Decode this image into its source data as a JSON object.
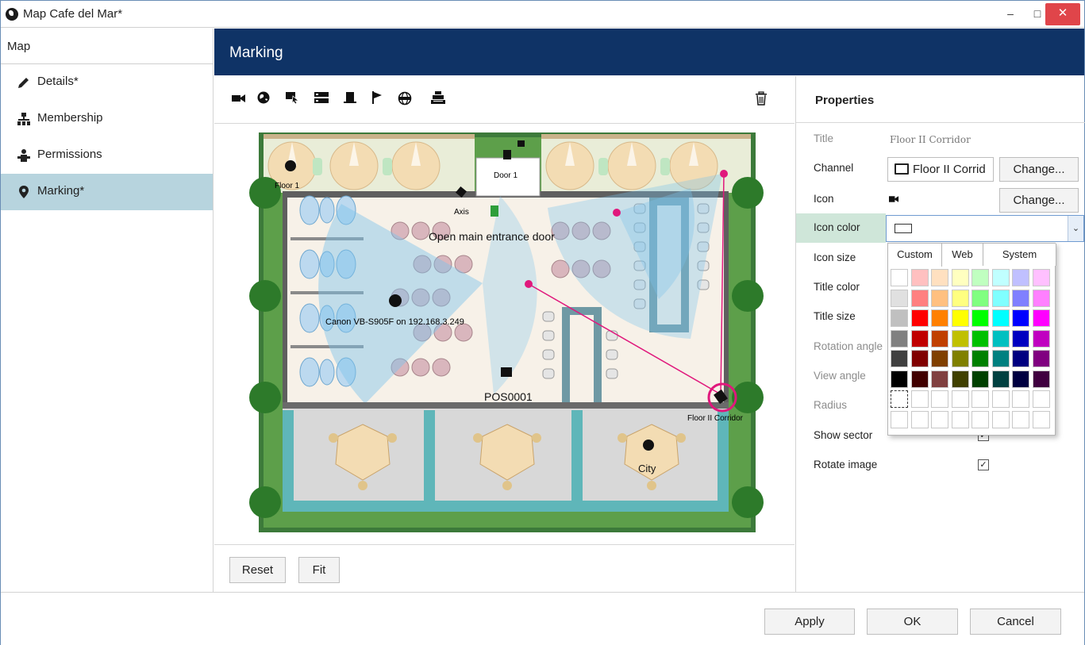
{
  "window": {
    "title": "Map Cafe del Mar*"
  },
  "nav": {
    "header": "Map",
    "items": [
      {
        "label": "Details*",
        "icon": "pencil-icon"
      },
      {
        "label": "Membership",
        "icon": "org-chart-icon"
      },
      {
        "label": "Permissions",
        "icon": "permissions-icon"
      },
      {
        "label": "Marking*",
        "icon": "location-pin-icon"
      }
    ]
  },
  "header": {
    "title": "Marking"
  },
  "toolbar": {
    "tools": [
      "camera-icon",
      "globe-icon",
      "select-icon",
      "server-icon",
      "door-icon",
      "flag-icon",
      "web-icon",
      "pos-terminal-icon"
    ],
    "delete": "trash-icon"
  },
  "map": {
    "labels": {
      "floor1": "Floor 1",
      "door1": "Door 1",
      "axis": "Axis",
      "entrance": "Open main entrance door",
      "canon": "Canon VB-S905F on 192.168.3.249",
      "pos": "POS0001",
      "corridor": "Floor II Corridor",
      "city": "City"
    }
  },
  "bottom_buttons": {
    "reset": "Reset",
    "fit": "Fit"
  },
  "properties": {
    "heading": "Properties",
    "title_label": "Title",
    "title_value": "Floor II Corridor",
    "channel_label": "Channel",
    "channel_value": "Floor II Corrid",
    "change_label": "Change...",
    "icon_label": "Icon",
    "icon_color_label": "Icon color",
    "icon_size_label": "Icon size",
    "title_color_label": "Title color",
    "title_size_label": "Title size",
    "rotation_label": "Rotation angle",
    "view_angle_label": "View angle",
    "radius_label": "Radius",
    "show_sector_label": "Show sector",
    "rotate_image_label": "Rotate image",
    "show_sector_checked": true,
    "rotate_image_checked": true
  },
  "color_popup": {
    "tabs": [
      "Custom",
      "Web",
      "System"
    ],
    "selected_tab": "Custom",
    "rows": [
      [
        "#ffffff",
        "#ffc0c0",
        "#ffe0c0",
        "#ffffc0",
        "#c0ffc0",
        "#c0ffff",
        "#c0c0ff",
        "#ffc0ff"
      ],
      [
        "#e0e0e0",
        "#ff8080",
        "#ffc080",
        "#ffff80",
        "#80ff80",
        "#80ffff",
        "#8080ff",
        "#ff80ff"
      ],
      [
        "#c0c0c0",
        "#ff0000",
        "#ff8000",
        "#ffff00",
        "#00ff00",
        "#00ffff",
        "#0000ff",
        "#ff00ff"
      ],
      [
        "#808080",
        "#c00000",
        "#c04000",
        "#c0c000",
        "#00c000",
        "#00c0c0",
        "#0000c0",
        "#c000c0"
      ],
      [
        "#404040",
        "#800000",
        "#804000",
        "#808000",
        "#008000",
        "#008080",
        "#000080",
        "#800080"
      ],
      [
        "#000000",
        "#400000",
        "#804040",
        "#404000",
        "#004000",
        "#004040",
        "#000040",
        "#400040"
      ],
      [
        "#ffffff",
        "#ffffff",
        "#ffffff",
        "#ffffff",
        "#ffffff",
        "#ffffff",
        "#ffffff",
        "#ffffff"
      ],
      [
        "#ffffff",
        "#ffffff",
        "#ffffff",
        "#ffffff",
        "#ffffff",
        "#ffffff",
        "#ffffff",
        "#ffffff"
      ]
    ]
  },
  "footer": {
    "apply": "Apply",
    "ok": "OK",
    "cancel": "Cancel"
  },
  "colors": {
    "header_bg": "#0f3366",
    "active_nav": "#b7d4de",
    "accent_pink": "#e0187c",
    "close_red": "#e0454a"
  }
}
